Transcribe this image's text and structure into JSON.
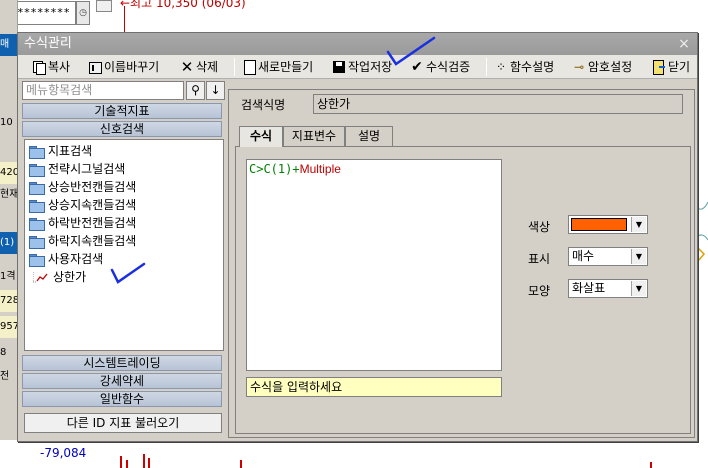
{
  "background": {
    "password_mask": "********",
    "hint_text": "←최고 10,350 (06/03)",
    "bottom_value": "-79,084",
    "side_labels": [
      "매",
      "10",
      "420",
      "현재",
      "(1)",
      "1격",
      "728",
      "957",
      "8",
      "전"
    ]
  },
  "dialog": {
    "title": "수식관리",
    "close": "×"
  },
  "toolbar": {
    "copy": "복사",
    "rename": "이름바꾸기",
    "delete": "삭제",
    "new": "새로만들기",
    "save": "작업저장",
    "verify": "수식검증",
    "func_desc": "함수설명",
    "password": "암호설정",
    "close": "닫기"
  },
  "left": {
    "search_placeholder": "메뉴항목검색",
    "search_icon": "search-icon",
    "down_icon": "arrow-down-icon",
    "categories_top": [
      "기술적지표",
      "신호검색"
    ],
    "tree": [
      {
        "label": "지표검색",
        "type": "folder"
      },
      {
        "label": "전략시그널검색",
        "type": "folder"
      },
      {
        "label": "상승반전캔들검색",
        "type": "folder"
      },
      {
        "label": "상승지속캔들검색",
        "type": "folder"
      },
      {
        "label": "하락반전캔들검색",
        "type": "folder"
      },
      {
        "label": "하락지속캔들검색",
        "type": "folder"
      },
      {
        "label": "사용자검색",
        "type": "folder"
      },
      {
        "label": "상한가",
        "type": "item"
      }
    ],
    "categories_bottom": [
      "시스템트레이딩",
      "강세약세",
      "일반함수"
    ],
    "load_button": "다른 ID 지표 불러오기"
  },
  "right": {
    "name_label": "검색식명",
    "name_value": "상한가",
    "tabs": [
      "수식",
      "지표변수",
      "설명"
    ],
    "formula_prefix": "C>C(1)+",
    "formula_var": "Multiple",
    "hint": "수식을 입력하세요",
    "color_label": "색상",
    "color_value": "#ff6000",
    "display_label": "표시",
    "display_value": "매수",
    "shape_label": "모양",
    "shape_value": "화살표"
  }
}
